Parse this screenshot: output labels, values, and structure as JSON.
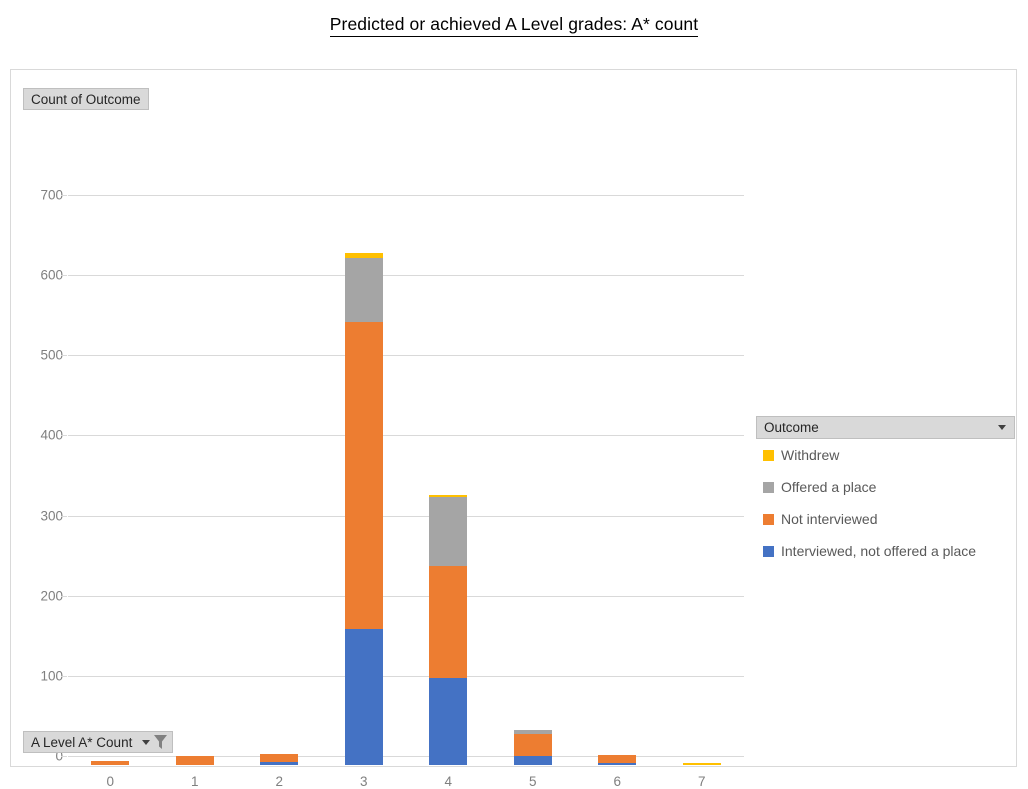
{
  "title": "Predicted or achieved A Level grades: A* count",
  "value_field_button": {
    "label": "Count of Outcome",
    "dropdown_icon": "chevron-down-icon"
  },
  "axis_field_button": {
    "label": "A Level A* Count",
    "dropdown_icon": "chevron-down-icon",
    "filter_icon": "funnel-filter-icon"
  },
  "legend": {
    "header_label": "Outcome",
    "header_dropdown_icon": "chevron-down-icon",
    "items": [
      {
        "label": "Withdrew",
        "color": "#FFC000"
      },
      {
        "label": "Offered a place",
        "color": "#A5A5A5"
      },
      {
        "label": "Not interviewed",
        "color": "#ED7D31"
      },
      {
        "label": "Interviewed, not offered a place",
        "color": "#4472C4"
      }
    ]
  },
  "axes": {
    "y_ticks": [
      "700",
      "600",
      "500",
      "400",
      "300",
      "200",
      "100",
      "0"
    ],
    "x_ticks": [
      "0",
      "1",
      "2",
      "3",
      "4",
      "5",
      "6",
      "7"
    ],
    "y_min": 0,
    "y_max": 700,
    "y_step": 100
  },
  "chart_data": {
    "type": "bar",
    "stacked": true,
    "title": "Predicted or achieved A Level grades: A* count",
    "xlabel": "A Level A* Count",
    "ylabel": "Count of Outcome",
    "categories": [
      "0",
      "1",
      "2",
      "3",
      "4",
      "5",
      "6",
      "7"
    ],
    "series": [
      {
        "name": "Interviewed, not offered a place",
        "color": "#4472C4",
        "values": [
          0,
          0,
          4,
          170,
          108,
          11,
          2,
          0
        ]
      },
      {
        "name": "Not interviewed",
        "color": "#ED7D31",
        "values": [
          5,
          11,
          10,
          383,
          140,
          28,
          10,
          0
        ]
      },
      {
        "name": "Offered a place",
        "color": "#A5A5A5",
        "values": [
          0,
          0,
          0,
          80,
          87,
          5,
          0,
          0
        ]
      },
      {
        "name": "Withdrew",
        "color": "#FFC000",
        "values": [
          0,
          0,
          0,
          6,
          2,
          0,
          0,
          2
        ]
      }
    ],
    "totals": [
      5,
      11,
      14,
      639,
      337,
      44,
      12,
      2
    ],
    "ylim": [
      0,
      700
    ],
    "grid": true,
    "legend_position": "right"
  }
}
